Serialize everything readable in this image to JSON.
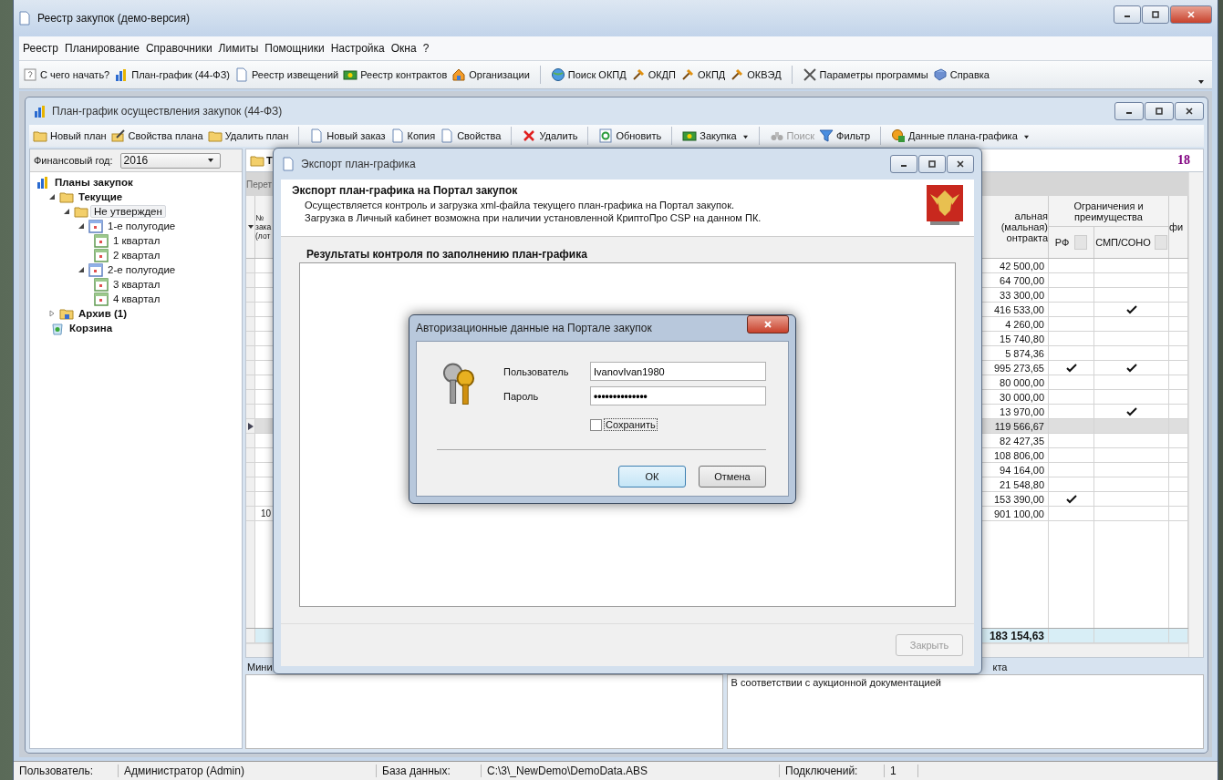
{
  "window": {
    "title": "Реестр закупок (демо-версия)"
  },
  "menu": [
    "Реестр",
    "Планирование",
    "Справочники",
    "Лимиты",
    "Помощники",
    "Настройка",
    "Окна",
    "?"
  ],
  "toolbar": [
    [
      "С чего начать?",
      "План-график (44-ФЗ)",
      "Реестр извещений",
      "Реестр контрактов",
      "Организации"
    ],
    [
      "Поиск ОКПД",
      "ОКДП",
      "ОКПД",
      "ОКВЭД"
    ],
    [
      "Параметры программы",
      "Справка"
    ]
  ],
  "plan_window": {
    "title": "План-график осуществления закупок (44-ФЗ)",
    "toolbar": [
      [
        {
          "label": "Новый план",
          "disabled": false,
          "dropdown": false
        },
        {
          "label": "Свойства плана",
          "disabled": false,
          "dropdown": false
        },
        {
          "label": "Удалить план",
          "disabled": false,
          "dropdown": false
        }
      ],
      [
        {
          "label": "Новый заказ",
          "disabled": false,
          "dropdown": false
        },
        {
          "label": "Копия",
          "disabled": false,
          "dropdown": false
        },
        {
          "label": "Свойства",
          "disabled": false,
          "dropdown": false
        }
      ],
      [
        {
          "label": "Удалить",
          "disabled": false,
          "dropdown": false
        }
      ],
      [
        {
          "label": "Обновить",
          "disabled": false,
          "dropdown": false
        }
      ],
      [
        {
          "label": "Закупка",
          "disabled": false,
          "dropdown": true
        }
      ],
      [
        {
          "label": "Поиск",
          "disabled": true,
          "dropdown": false
        },
        {
          "label": "Фильтр",
          "disabled": false,
          "dropdown": false
        }
      ],
      [
        {
          "label": "Данные плана-графика",
          "disabled": false,
          "dropdown": true
        }
      ]
    ],
    "year_label": "Финансовый год:",
    "year_value": "2016",
    "tree": [
      {
        "label": "Планы закупок",
        "kind": "root",
        "bold": true,
        "selected": false,
        "children": [
          {
            "label": "Текущие",
            "kind": "folder",
            "bold": true,
            "selected": false,
            "expanded": true,
            "children": [
              {
                "label": "Не утвержден",
                "kind": "folder",
                "bold": false,
                "selected": true,
                "expanded": true,
                "children": [
                  {
                    "label": "1-е полугодие",
                    "kind": "half",
                    "bold": false,
                    "selected": false,
                    "expanded": true,
                    "children": [
                      {
                        "label": "1 квартал",
                        "kind": "quarter",
                        "bold": false,
                        "selected": false
                      },
                      {
                        "label": "2 квартал",
                        "kind": "quarter",
                        "bold": false,
                        "selected": false
                      }
                    ]
                  },
                  {
                    "label": "2-е полугодие",
                    "kind": "half",
                    "bold": false,
                    "selected": false,
                    "expanded": true,
                    "children": [
                      {
                        "label": "3 квартал",
                        "kind": "quarter",
                        "bold": false,
                        "selected": false
                      },
                      {
                        "label": "4 квартал",
                        "kind": "quarter",
                        "bold": false,
                        "selected": false
                      }
                    ]
                  }
                ]
              }
            ]
          },
          {
            "label": "Архив (1)",
            "kind": "archive",
            "bold": true,
            "selected": false,
            "expanded": false
          },
          {
            "label": "Корзина",
            "kind": "trash",
            "bold": true,
            "selected": false
          }
        ]
      }
    ],
    "tab_label": "Т",
    "count": "18",
    "strip_text": "Перет",
    "table": {
      "column_1": "№ зака (лот",
      "column_2": "альная (мальная) онтракта",
      "group": "Ограничения и преимущества",
      "column_3": "РФ",
      "column_4": "СМП/СОНО",
      "column_5": "фи",
      "rows": [
        {
          "column_1": "",
          "sum": "42 500,00",
          "rf": false,
          "smp": false,
          "selected": false
        },
        {
          "column_1": "",
          "sum": "64 700,00",
          "rf": false,
          "smp": false,
          "selected": false
        },
        {
          "column_1": "",
          "sum": "33 300,00",
          "rf": false,
          "smp": false,
          "selected": false
        },
        {
          "column_1": "",
          "sum": "416 533,00",
          "rf": false,
          "smp": true,
          "selected": false
        },
        {
          "column_1": "",
          "sum": "4 260,00",
          "rf": false,
          "smp": false,
          "selected": false
        },
        {
          "column_1": "",
          "sum": "15 740,80",
          "rf": false,
          "smp": false,
          "selected": false
        },
        {
          "column_1": "",
          "sum": "5 874,36",
          "rf": false,
          "smp": false,
          "selected": false
        },
        {
          "column_1": "",
          "sum": "995 273,65",
          "rf": true,
          "smp": true,
          "selected": false
        },
        {
          "column_1": "",
          "sum": "80 000,00",
          "rf": false,
          "smp": false,
          "selected": false
        },
        {
          "column_1": "",
          "sum": "30 000,00",
          "rf": false,
          "smp": false,
          "selected": false
        },
        {
          "column_1": "",
          "sum": "13 970,00",
          "rf": false,
          "smp": true,
          "selected": false
        },
        {
          "column_1": "",
          "sum": "119 566,67",
          "rf": false,
          "smp": false,
          "selected": true
        },
        {
          "column_1": "",
          "sum": "82 427,35",
          "rf": false,
          "smp": false,
          "selected": false
        },
        {
          "column_1": "",
          "sum": "108 806,00",
          "rf": false,
          "smp": false,
          "selected": false
        },
        {
          "column_1": "",
          "sum": "94 164,00",
          "rf": false,
          "smp": false,
          "selected": false
        },
        {
          "column_1": "",
          "sum": "21 548,80",
          "rf": false,
          "smp": false,
          "selected": false
        },
        {
          "column_1": "",
          "sum": "153 390,00",
          "rf": true,
          "smp": false,
          "selected": false
        },
        {
          "column_1": "10",
          "sum": "901 100,00",
          "rf": false,
          "smp": false,
          "selected": false
        }
      ],
      "total": "183 154,63"
    },
    "bottom_left_label": "Мини",
    "bottom_right_label": "кта",
    "bottom_right_text": "В соответствии с аукционной документацией"
  },
  "export_dialog": {
    "title": "Экспорт план-графика",
    "heading": "Экспорт план-графика на Портал закупок",
    "lines": [
      "Осуществляется контроль и загрузка xml-файла текущего план-графика на Портал закупок.",
      "Загрузка в Личный кабинет возможна при наличии установленной КриптоПро CSP на данном ПК."
    ],
    "group_title": "Результаты контроля по заполнению план-графика",
    "button": {
      "label": "Закрыть",
      "disabled": true
    }
  },
  "auth_dialog": {
    "title": "Авторизационные данные на Портале закупок",
    "fields": [
      {
        "label": "Пользователь",
        "value": "IvanovIvan1980",
        "kind": "text"
      },
      {
        "label": "Пароль",
        "value": "••••••••••••••",
        "kind": "password"
      }
    ],
    "remember": {
      "label": "Сохранить",
      "checked": false
    },
    "buttons": [
      {
        "label": "ОК",
        "default": true
      },
      {
        "label": "Отмена",
        "default": false
      }
    ]
  },
  "status_bar": [
    {
      "label": "Пользователь:",
      "value": "Администратор (Admin)"
    },
    {
      "label": "База данных:",
      "value": "C:\\3\\_NewDemo\\DemoData.ABS"
    },
    {
      "label": "Подключений:",
      "value": "1"
    }
  ]
}
